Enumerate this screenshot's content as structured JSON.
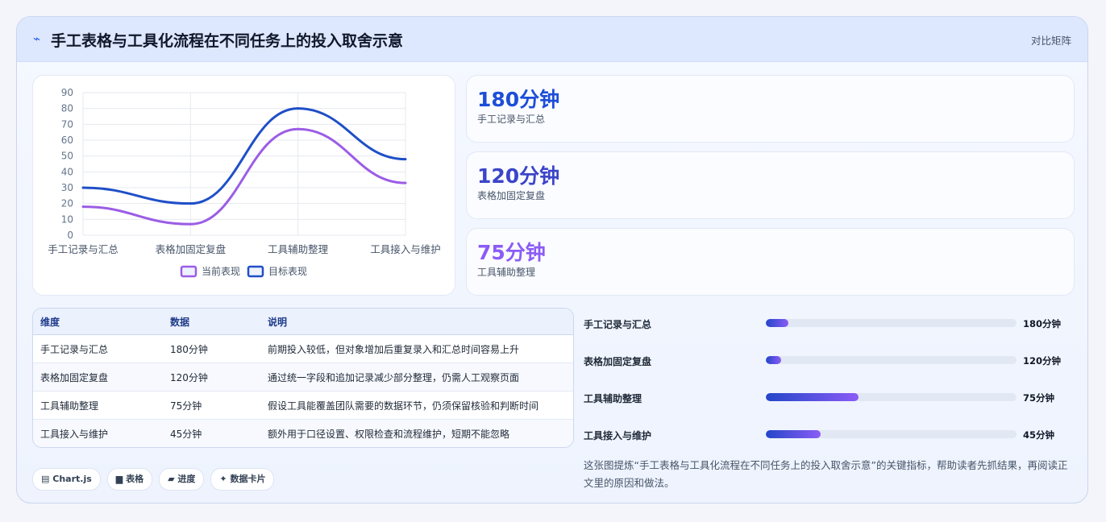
{
  "header": {
    "icon": "spark-icon",
    "title": "手工表格与工具化流程在不同任务上的投入取舍示意",
    "right_label": "对比矩阵"
  },
  "chart_data": {
    "type": "line",
    "categories": [
      "手工记录与汇总",
      "表格加固定复盘",
      "工具辅助整理",
      "工具接入与维护"
    ],
    "series": [
      {
        "name": "当前表现",
        "values": [
          18,
          7,
          67,
          33
        ],
        "color": "#9b5de5"
      },
      {
        "name": "目标表现",
        "values": [
          30,
          20,
          80,
          48
        ],
        "color": "#1f4fc7"
      }
    ],
    "ylim": [
      0,
      90
    ],
    "yticks": [
      0,
      10,
      20,
      30,
      40,
      50,
      60,
      70,
      80,
      90
    ],
    "grid": true,
    "legend_position": "bottom"
  },
  "stats": [
    {
      "value": "180分钟",
      "label": "手工记录与汇总",
      "color": "#1d4ed8"
    },
    {
      "value": "120分钟",
      "label": "表格加固定复盘",
      "color": "#3b45c9"
    },
    {
      "value": "75分钟",
      "label": "工具辅助整理",
      "color": "#8b5cf6"
    }
  ],
  "table": {
    "headers": [
      "维度",
      "数据",
      "说明"
    ],
    "rows": [
      [
        "手工记录与汇总",
        "180分钟",
        "前期投入较低，但对象增加后重复录入和汇总时间容易上升"
      ],
      [
        "表格加固定复盘",
        "120分钟",
        "通过统一字段和追加记录减少部分整理，仍需人工观察页面"
      ],
      [
        "工具辅助整理",
        "75分钟",
        "假设工具能覆盖团队需要的数据环节，仍须保留核验和判断时间"
      ],
      [
        "工具接入与维护",
        "45分钟",
        "额外用于口径设置、权限检查和流程维护，短期不能忽略"
      ]
    ]
  },
  "chips": [
    {
      "icon": "chart-icon",
      "glyph": "▤",
      "label": "Chart.js"
    },
    {
      "icon": "table-icon",
      "glyph": "▆",
      "label": "表格"
    },
    {
      "icon": "progress-icon",
      "glyph": "▰",
      "label": "进度"
    },
    {
      "icon": "sparkle-icon",
      "glyph": "✦",
      "label": "数据卡片"
    }
  ],
  "progress": [
    {
      "label": "手工记录与汇总",
      "value": "180分钟",
      "fill_fraction": 0.09
    },
    {
      "label": "表格加固定复盘",
      "value": "120分钟",
      "fill_fraction": 0.06
    },
    {
      "label": "工具辅助整理",
      "value": "75分钟",
      "fill_fraction": 0.37
    },
    {
      "label": "工具接入与维护",
      "value": "45分钟",
      "fill_fraction": 0.22
    }
  ],
  "summary": "这张图提炼“手工表格与工具化流程在不同任务上的投入取舍示意”的关键指标，帮助读者先抓结果，再阅读正文里的原因和做法。"
}
